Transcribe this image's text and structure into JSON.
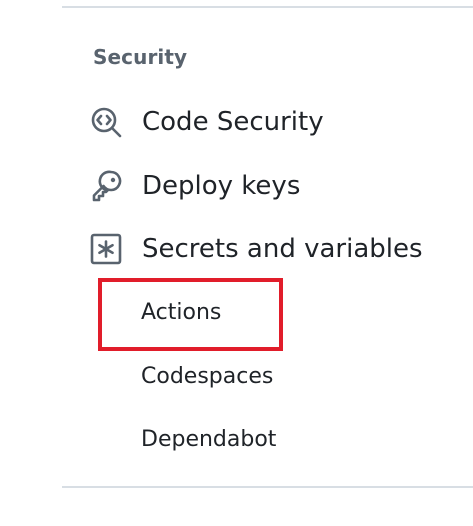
{
  "section": {
    "heading": "Security"
  },
  "nav": {
    "items": [
      {
        "label": "Code Security",
        "icon": "code-security-icon"
      },
      {
        "label": "Deploy keys",
        "icon": "key-icon"
      },
      {
        "label": "Secrets and variables",
        "icon": "asterisk-box-icon"
      }
    ],
    "sub_items": [
      {
        "label": "Actions",
        "highlighted": true
      },
      {
        "label": "Codespaces"
      },
      {
        "label": "Dependabot"
      }
    ]
  },
  "colors": {
    "highlight": "#e11d2a",
    "icon": "#59636e",
    "text": "#1f2328",
    "divider": "#d8dee4"
  }
}
